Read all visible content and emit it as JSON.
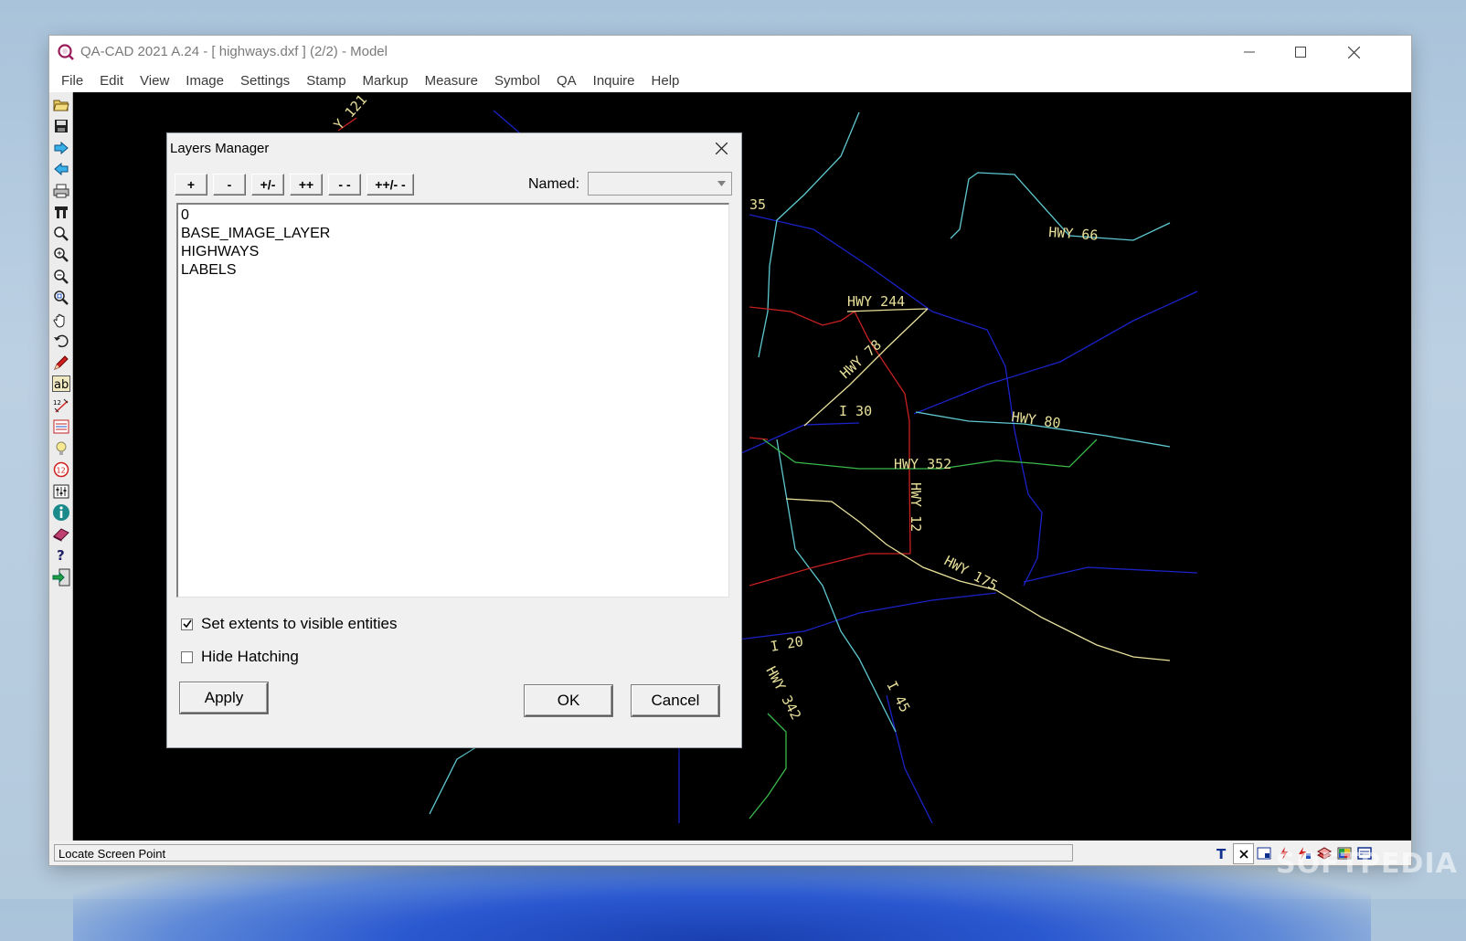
{
  "window": {
    "title": "QA-CAD 2021 A.24  -  [ highways.dxf ] (2/2)  -  Model"
  },
  "menu": [
    "File",
    "Edit",
    "View",
    "Image",
    "Settings",
    "Stamp",
    "Markup",
    "Measure",
    "Symbol",
    "QA",
    "Inquire",
    "Help"
  ],
  "toolbar_icons": [
    "open-icon",
    "save-icon",
    "forward-icon",
    "back-icon",
    "print-icon",
    "tool-icon",
    "zoom-icon",
    "zoom-in-icon",
    "zoom-out-icon",
    "zoom-window-icon",
    "pan-icon",
    "undo-icon",
    "pencil-icon",
    "text-icon",
    "dimension-icon",
    "layer-icon",
    "bulb-icon",
    "counter-icon",
    "properties-icon",
    "info-icon",
    "book-icon",
    "help-icon",
    "exit-icon"
  ],
  "map_labels": {
    "hwy121": "Y 121",
    "i35": "35",
    "hwy66": "HWY 66",
    "hwy244": "HWY 244",
    "hwy78": "HWY 78",
    "i30": "I 30",
    "hwy80": "HWY 80",
    "hwy352": "HWY 352",
    "hwy12": "HWY 12",
    "hwy175": "HWY 175",
    "i20": "I 20",
    "hwy342": "HWY 342",
    "i45": "I 45"
  },
  "colors": {
    "highway_yellow": "#e8e09a",
    "road_blue": "#1a22c8",
    "road_cyan": "#5fc8d0",
    "road_red": "#c82020",
    "road_green": "#3ab84a",
    "canvas_bg": "#000000"
  },
  "dialog": {
    "title": "Layers Manager",
    "buttons": [
      "+",
      "-",
      "+/-",
      "++",
      "- -",
      "++/- -"
    ],
    "named_label": "Named:",
    "named_value": "",
    "layers": [
      "0",
      "BASE_IMAGE_LAYER",
      "HIGHWAYS",
      "LABELS"
    ],
    "set_extents_label": "Set extents to visible entities",
    "set_extents_checked": true,
    "hide_hatching_label": "Hide Hatching",
    "hide_hatching_checked": false,
    "apply_label": "Apply",
    "ok_label": "OK",
    "cancel_label": "Cancel"
  },
  "status": {
    "prompt": "Locate Screen Point",
    "icons": [
      "text-toggle-icon",
      "close-small-icon",
      "window-icon",
      "snap-icon",
      "snap2-icon",
      "layers-icon",
      "color-icon",
      "display-icon"
    ]
  },
  "watermark": "SOFTPEDIA"
}
